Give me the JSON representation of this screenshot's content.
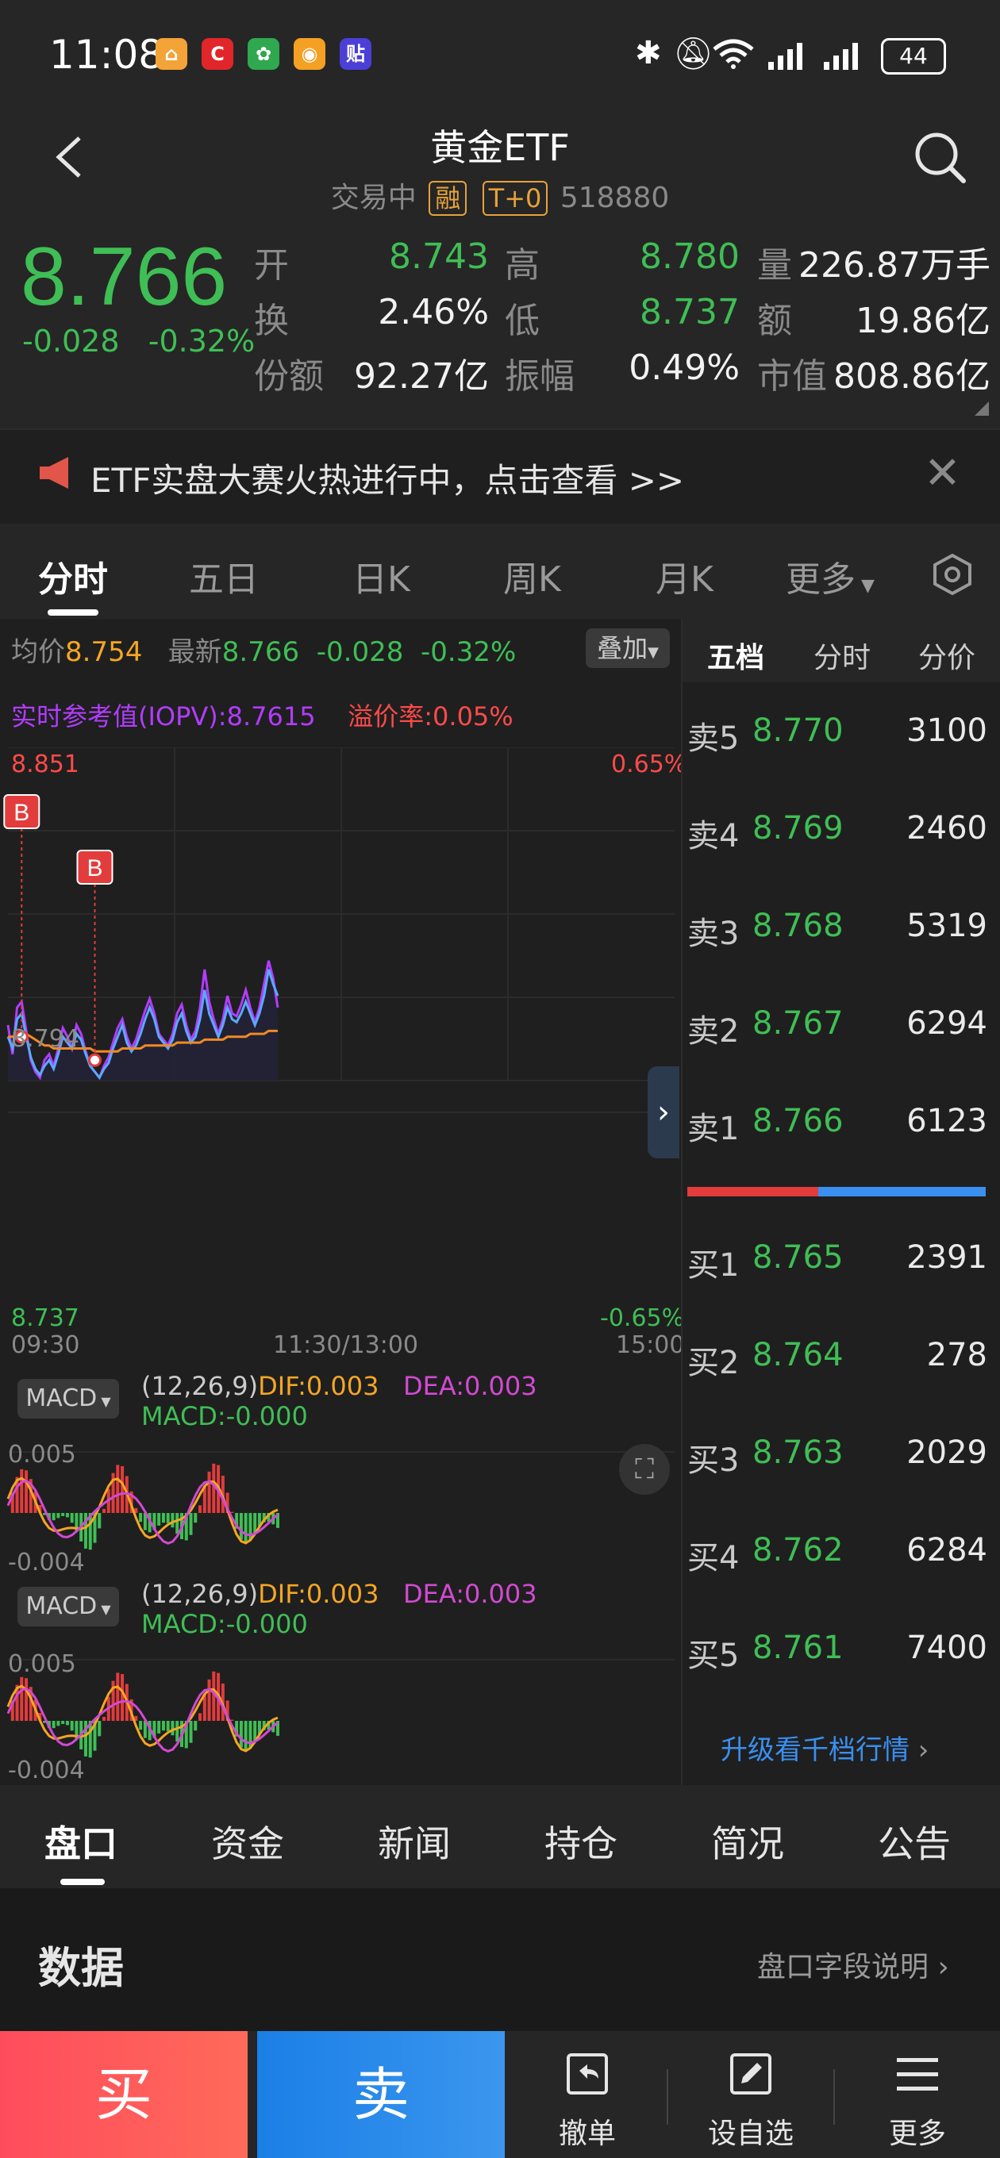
{
  "status_bar": {
    "time": "11:08",
    "battery": "44",
    "apps": [
      {
        "name": "home-app-icon",
        "text": "⌂",
        "color": "#f3a338"
      },
      {
        "name": "c-app-icon",
        "text": "C",
        "color": "#e0262a"
      },
      {
        "name": "taobao-fruit-app-icon",
        "text": "✿",
        "color": "#2fa84f"
      },
      {
        "name": "orange-app-icon",
        "text": "◉",
        "color": "#f4a023"
      },
      {
        "name": "purple-app-icon",
        "text": "贴",
        "color": "#4a3fd6"
      }
    ]
  },
  "header": {
    "title": "黄金ETF",
    "status": "交易中",
    "tag_margin": "融",
    "tag_t0": "T+0",
    "code": "518880"
  },
  "quote": {
    "price": "8.766",
    "change": "-0.028",
    "change_pct": "-0.32%",
    "fields": [
      {
        "label": "开",
        "value": "8.743",
        "color": "green"
      },
      {
        "label": "高",
        "value": "8.780",
        "color": "green"
      },
      {
        "label": "量",
        "value": "226.87万手",
        "color": "white"
      },
      {
        "label": "换",
        "value": "2.46%",
        "color": "white"
      },
      {
        "label": "低",
        "value": "8.737",
        "color": "green"
      },
      {
        "label": "额",
        "value": "19.86亿",
        "color": "white"
      },
      {
        "label": "份额",
        "value": "92.27亿",
        "color": "white"
      },
      {
        "label": "振幅",
        "value": "0.49%",
        "color": "white"
      },
      {
        "label": "市值",
        "value": "808.86亿",
        "color": "white"
      }
    ]
  },
  "banner": {
    "text": "ETF实盘大赛火热进行中，点击查看 >>"
  },
  "chart_tabs": [
    "分时",
    "五日",
    "日K",
    "周K",
    "月K",
    "更多"
  ],
  "chart_info": {
    "avg_label": "均价",
    "avg_value": "8.754",
    "latest_label": "最新",
    "latest_value": "8.766",
    "latest_change": "-0.028",
    "latest_pct": "-0.32%",
    "overlay_btn": "叠加",
    "iopv_label": "实时参考值(IOPV):",
    "iopv_value": "8.7615",
    "premium_label": "溢价率:",
    "premium_value": "0.05%",
    "y_top": "8.851",
    "y_mid": "8.794",
    "y_bottom": "8.737",
    "pct_top": "0.65%",
    "pct_bottom": "-0.65%",
    "t_start": "09:30",
    "t_mid": "11:30/13:00",
    "t_end": "15:00",
    "marker_b": "B"
  },
  "macd": [
    {
      "btn": "MACD",
      "params": "(12,26,9)",
      "dif": "DIF:0.003",
      "dea": "DEA:0.003",
      "macd": "MACD:-0.000",
      "y_top": "0.005",
      "y_bottom": "-0.004"
    },
    {
      "btn": "MACD",
      "params": "(12,26,9)",
      "dif": "DIF:0.003",
      "dea": "DEA:0.003",
      "macd": "MACD:-0.000",
      "y_top": "0.005",
      "y_bottom": "-0.004"
    }
  ],
  "chart_data": {
    "type": "line",
    "title": "",
    "xlabel": "",
    "ylabel": "",
    "ylim": [
      8.737,
      8.851
    ],
    "x_ticks": [
      "09:30",
      "11:30/13:00",
      "15:00"
    ],
    "series": [
      {
        "name": "最新",
        "color": "#5aa9ff",
        "values": [
          8.752,
          8.748,
          8.758,
          8.76,
          8.752,
          8.745,
          8.741,
          8.739,
          8.742,
          8.744,
          8.741,
          8.746,
          8.752,
          8.75,
          8.748,
          8.753,
          8.751,
          8.746,
          8.742,
          8.74,
          8.738,
          8.741,
          8.743,
          8.748,
          8.752,
          8.756,
          8.75,
          8.747,
          8.749,
          8.753,
          8.758,
          8.762,
          8.758,
          8.752,
          8.75,
          8.748,
          8.751,
          8.757,
          8.76,
          8.754,
          8.75,
          8.752,
          8.758,
          8.768,
          8.76,
          8.756,
          8.752,
          8.756,
          8.762,
          8.758,
          8.757,
          8.76,
          8.764,
          8.76,
          8.756,
          8.76,
          8.766,
          8.775,
          8.77,
          8.766
        ]
      },
      {
        "name": "均价",
        "color": "#f08a24",
        "values": [
          8.752,
          8.752,
          8.753,
          8.754,
          8.753,
          8.752,
          8.751,
          8.75,
          8.749,
          8.749,
          8.748,
          8.748,
          8.748,
          8.748,
          8.748,
          8.748,
          8.748,
          8.748,
          8.748,
          8.747,
          8.747,
          8.747,
          8.747,
          8.747,
          8.747,
          8.748,
          8.748,
          8.748,
          8.748,
          8.748,
          8.749,
          8.749,
          8.749,
          8.749,
          8.749,
          8.749,
          8.749,
          8.75,
          8.75,
          8.75,
          8.75,
          8.75,
          8.75,
          8.751,
          8.751,
          8.751,
          8.751,
          8.751,
          8.752,
          8.752,
          8.752,
          8.752,
          8.752,
          8.753,
          8.753,
          8.753,
          8.753,
          8.754,
          8.754,
          8.754
        ]
      },
      {
        "name": "IOPV",
        "color": "#b23cff",
        "values": [
          8.756,
          8.746,
          8.762,
          8.764,
          8.754,
          8.744,
          8.74,
          8.738,
          8.744,
          8.746,
          8.742,
          8.748,
          8.755,
          8.752,
          8.748,
          8.756,
          8.753,
          8.747,
          8.742,
          8.74,
          8.738,
          8.742,
          8.745,
          8.75,
          8.755,
          8.758,
          8.752,
          8.748,
          8.751,
          8.756,
          8.761,
          8.765,
          8.76,
          8.753,
          8.751,
          8.749,
          8.753,
          8.76,
          8.763,
          8.756,
          8.751,
          8.754,
          8.762,
          8.775,
          8.764,
          8.758,
          8.753,
          8.758,
          8.766,
          8.76,
          8.759,
          8.763,
          8.768,
          8.762,
          8.757,
          8.762,
          8.77,
          8.778,
          8.772,
          8.762
        ]
      }
    ],
    "buy_markers": [
      {
        "index": 3,
        "value": 8.752
      },
      {
        "index": 19,
        "value": 8.744
      }
    ]
  },
  "order_book": {
    "tabs": [
      "五档",
      "分时",
      "分价"
    ],
    "asks": [
      {
        "label": "卖5",
        "price": "8.770",
        "vol": "3100"
      },
      {
        "label": "卖4",
        "price": "8.769",
        "vol": "2460"
      },
      {
        "label": "卖3",
        "price": "8.768",
        "vol": "5319"
      },
      {
        "label": "卖2",
        "price": "8.767",
        "vol": "6294"
      },
      {
        "label": "卖1",
        "price": "8.766",
        "vol": "6123"
      }
    ],
    "bids": [
      {
        "label": "买1",
        "price": "8.765",
        "vol": "2391"
      },
      {
        "label": "买2",
        "price": "8.764",
        "vol": "278"
      },
      {
        "label": "买3",
        "price": "8.763",
        "vol": "2029"
      },
      {
        "label": "买4",
        "price": "8.762",
        "vol": "6284"
      },
      {
        "label": "买5",
        "price": "8.761",
        "vol": "7400"
      }
    ],
    "buy_ratio": 0.44,
    "upgrade": "升级看千档行情"
  },
  "bottom_tabs": [
    "盘口",
    "资金",
    "新闻",
    "持仓",
    "简况",
    "公告"
  ],
  "data_section": {
    "title": "数据",
    "link": "盘口字段说明"
  },
  "action_bar": {
    "buy": "买",
    "sell": "卖",
    "cancel": "撤单",
    "watchlist": "设自选",
    "more": "更多"
  },
  "colors": {
    "up": "#ff4a4a",
    "down": "#3fbe55",
    "accent_blue": "#3a8ff0",
    "orange": "#f5a623",
    "magenta": "#d24ad2"
  }
}
